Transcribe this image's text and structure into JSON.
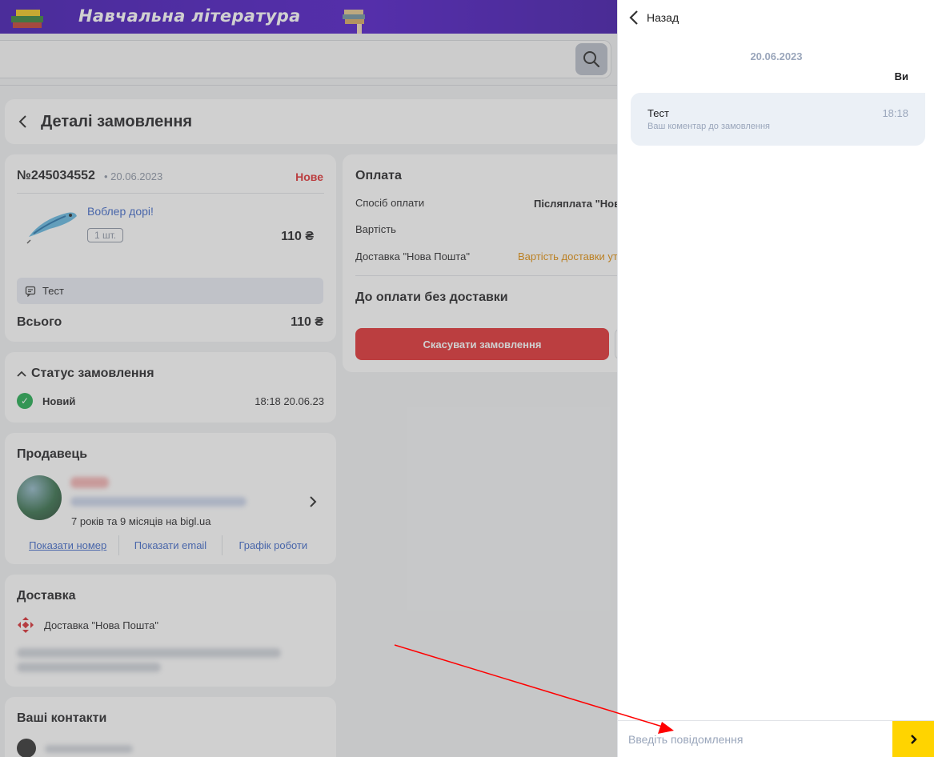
{
  "banner": {
    "text": "Навчальна література"
  },
  "search": {
    "placeholder": ""
  },
  "order_page": {
    "title": "Деталі замовлення",
    "order": {
      "number": "№245034552",
      "date": "• 20.06.2023",
      "status": "Нове",
      "product_name": "Воблер дорі!",
      "qty": "1 шт.",
      "price": "110 ₴",
      "comment": "Тест",
      "total_label": "Всього",
      "total_value": "110 ₴"
    },
    "status_section": {
      "title": "Статус замовлення",
      "state": "Новий",
      "timestamp": "18:18 20.06.23"
    },
    "seller": {
      "title": "Продавець",
      "years": "7 років та 9 місяців на bigl.ua",
      "links": [
        "Показати номер",
        "Показати email",
        "Графік роботи"
      ]
    },
    "delivery": {
      "title": "Доставка",
      "method": "Доставка \"Нова Пошта\""
    },
    "contacts": {
      "title": "Ваші контакти"
    },
    "payment": {
      "title": "Оплата",
      "method_label": "Спосіб оплати",
      "method_value": "Післяплата \"Нов",
      "cost_label": "Вартість",
      "delivery_label": "Доставка \"Нова Пошта\"",
      "delivery_value": "Вартість доставки ут",
      "due_label": "До оплати без доставки",
      "cancel_button": "Скасувати замовлення"
    }
  },
  "chat": {
    "back_label": "Назад",
    "date": "20.06.2023",
    "you_label": "Ви",
    "message_text": "Тест",
    "message_time": "18:18",
    "message_sub": "Ваш коментар до замовлення",
    "input_placeholder": "Введіть повідомлення"
  },
  "colors": {
    "accent_red": "#e0292b",
    "link_blue": "#3863c7",
    "send_yellow": "#ffd400",
    "banner_purple": "#4a12c8",
    "annotation_red": "#ff0000"
  }
}
